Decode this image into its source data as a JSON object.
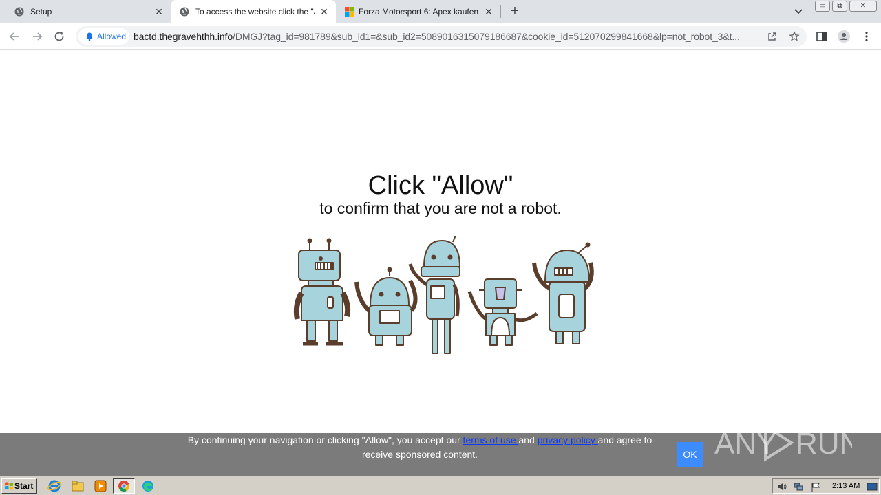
{
  "tabs": [
    {
      "title": "Setup",
      "close": "✕"
    },
    {
      "title": "To access the website click the \"Allow\"",
      "close": "✕"
    },
    {
      "title": "Forza Motorsport 6: Apex kaufen – Micr",
      "close": "✕"
    }
  ],
  "new_tab": "+",
  "window_controls": {
    "minimize": "▭",
    "restore": "⧉",
    "close": "✕"
  },
  "address_bar": {
    "permission_chip": "Allowed",
    "url_host": "bactd.thegravehthh.info",
    "url_path": "/DMGJ?tag_id=981789&sub_id1=&sub_id2=5089016315079186687&cookie_id=512070299841668&lp=not_robot_3&t..."
  },
  "page": {
    "headline": "Click \"Allow\"",
    "subline": "to confirm that you are not a robot."
  },
  "cookie_bar": {
    "text_before": "By continuing your navigation or clicking \"Allow\", you accept our ",
    "terms_link": "terms of use ",
    "text_and": "and ",
    "privacy_link": "privacy policy ",
    "text_after": "and agree to receive sponsored content.",
    "ok_label": "OK"
  },
  "watermark": "ANY RUN",
  "taskbar": {
    "start_label": "Start",
    "clock": "2:13 AM"
  },
  "colors": {
    "robot_fill": "#a7d3dc",
    "robot_stroke": "#5a3e2b",
    "cookie_bg": "#7b7b7b",
    "ok_bg": "#3d8cff",
    "link": "#0b3bff",
    "chip_text": "#1a73e8"
  }
}
